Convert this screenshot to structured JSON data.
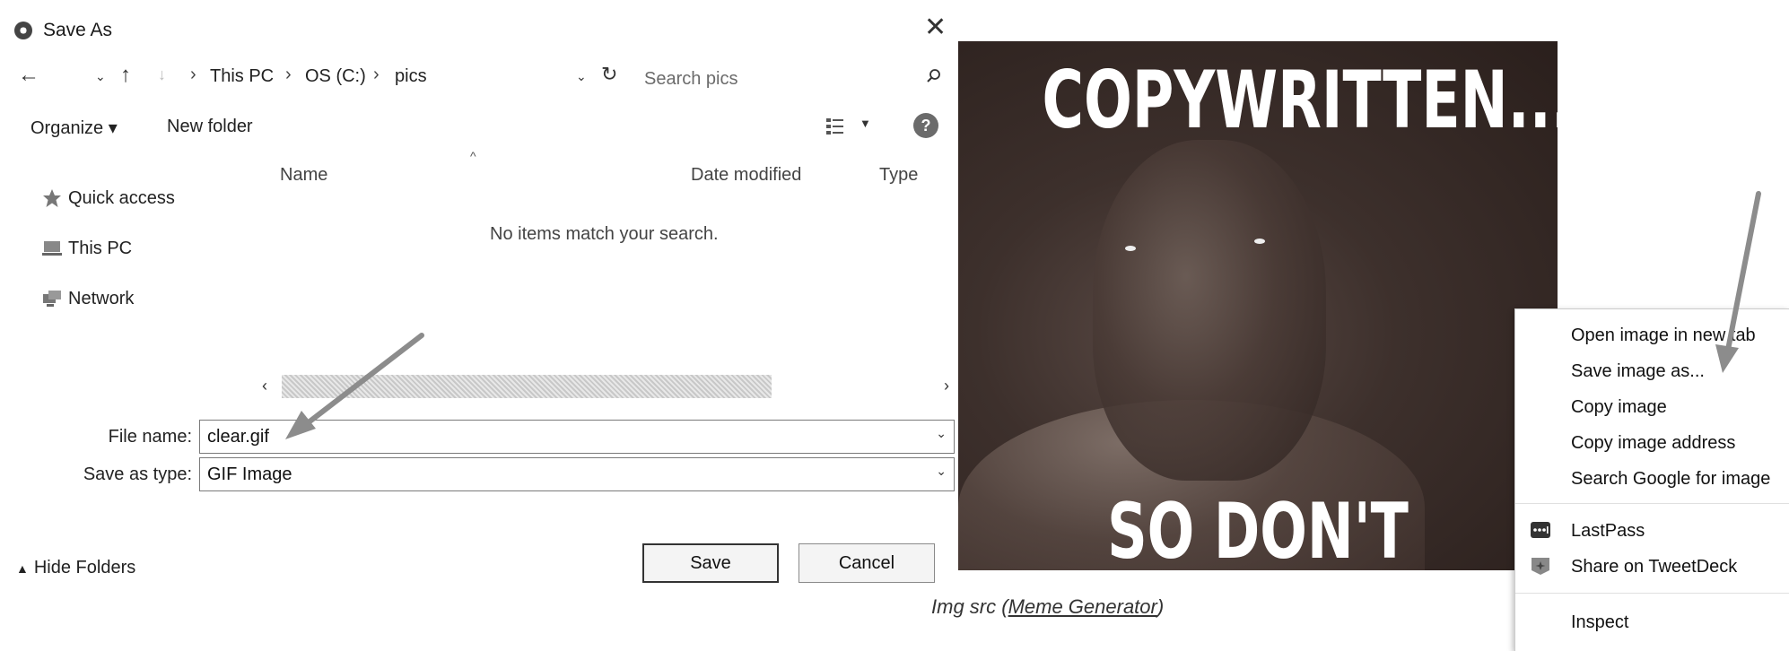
{
  "dialog": {
    "title": "Save As",
    "breadcrumb": [
      "This PC",
      "OS (C:)",
      "pics"
    ],
    "search_placeholder": "Search pics",
    "toolbar": {
      "organize": "Organize ▾",
      "new_folder": "New folder"
    },
    "columns": {
      "name": "Name",
      "date_modified": "Date modified",
      "type": "Type"
    },
    "nav_pane": [
      "Quick access",
      "This PC",
      "Network"
    ],
    "empty_message": "No items match your search.",
    "file_name_label": "File name:",
    "file_name_value": "clear.gif",
    "save_as_type_label": "Save as type:",
    "save_as_type_value": "GIF Image",
    "hide_folders": "Hide Folders",
    "save_button": "Save",
    "cancel_button": "Cancel"
  },
  "meme": {
    "top_text": "COPYWRITTEN.....",
    "bottom_text": "SO DON'T COPY ME!!!"
  },
  "caption": {
    "prefix": "Img src (",
    "link": "Meme Generator",
    "suffix": ")"
  },
  "context_menu": {
    "items": [
      "Open image in new tab",
      "Save image as...",
      "Copy image",
      "Copy image address",
      "Search Google for image",
      "LastPass",
      "Share on TweetDeck",
      "Inspect"
    ]
  },
  "icons": {
    "back": "back-arrow-icon",
    "forward": "forward-arrow-icon",
    "up": "up-arrow-icon",
    "refresh": "refresh-icon",
    "search": "search-icon",
    "help": "help-icon",
    "view": "view-options-icon",
    "lastpass": "lastpass-icon",
    "tweetdeck": "tweetdeck-icon"
  },
  "colors": {
    "annotation_arrow": "#8c8c8c",
    "meme_background": "#3d302c"
  }
}
